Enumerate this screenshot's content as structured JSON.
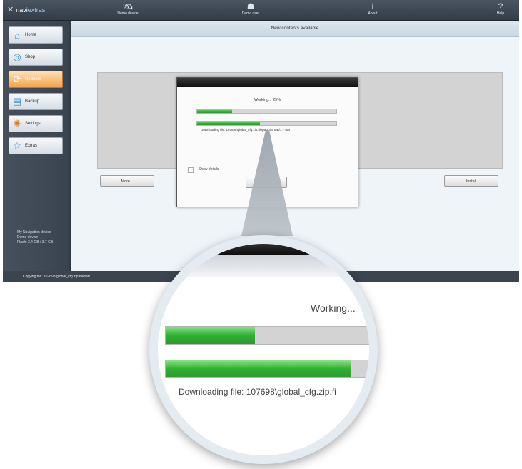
{
  "app": {
    "logo": {
      "prefix": "navi",
      "suffix": "extras"
    },
    "topbar": [
      {
        "label": "Demo device",
        "icon": "satellite-icon"
      },
      {
        "label": "Demo user",
        "icon": "user-icon"
      },
      {
        "label": "About",
        "icon": "info-icon"
      },
      {
        "label": "Help",
        "icon": "help-icon"
      }
    ],
    "sidebar": {
      "items": [
        {
          "label": "Home",
          "icon": "house-icon"
        },
        {
          "label": "Shop",
          "icon": "shop-icon"
        },
        {
          "label": "Updates",
          "icon": "updates-icon",
          "active": true
        },
        {
          "label": "Backup",
          "icon": "backup-icon"
        },
        {
          "label": "Settings",
          "icon": "gears-icon"
        },
        {
          "label": "Extras",
          "icon": "star-icon"
        }
      ],
      "device_info": {
        "name": "My Navigation device",
        "type": "Demo device",
        "flash": "Flash: 3.4 GB / 3.7 GB"
      }
    },
    "main": {
      "title": "New contents available",
      "more_button": "More...",
      "install_button": "Install"
    },
    "statusbar": "Copying file: 107698\\global_cfg.zip.filepart"
  },
  "dialog": {
    "working": "Working... 25%",
    "overall_progress": 0.25,
    "file_progress": 0.45,
    "download": "Downloading file: 107698\\global_cfg.zip.filepart 3.9 MB/7.7 MB",
    "show_details": "Show details"
  },
  "magnifier": {
    "working": "Working...",
    "download": "Downloading file:  107698\\global_cfg.zip.fi"
  }
}
